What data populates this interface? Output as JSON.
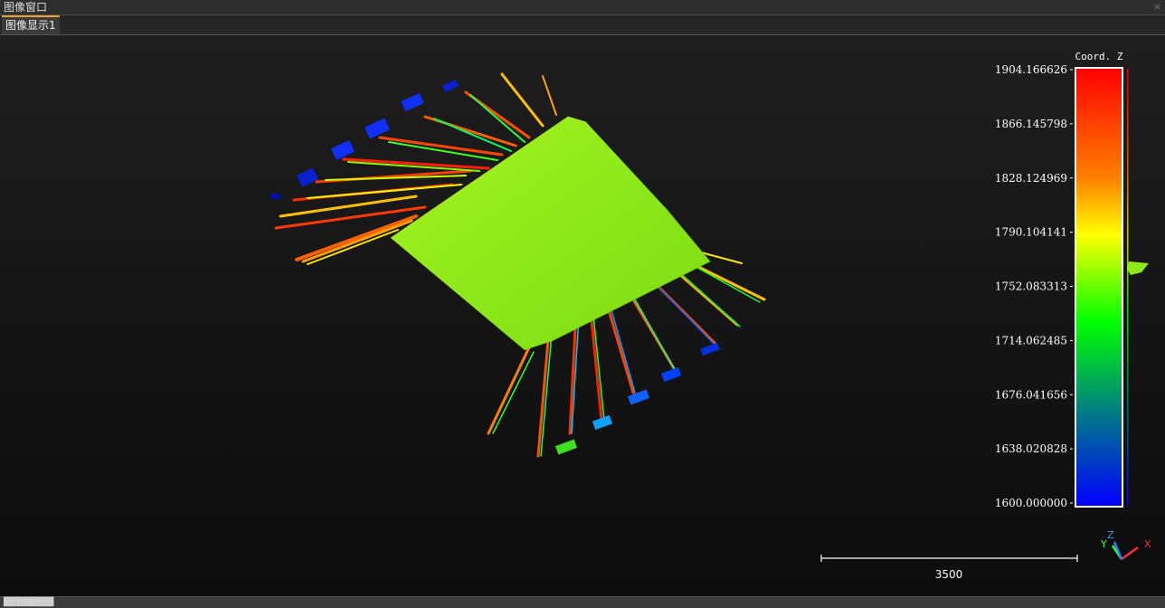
{
  "window": {
    "title": "图像窗口",
    "close_glyph": "×"
  },
  "tabs": [
    {
      "label": "图像显示1",
      "active": true
    }
  ],
  "viewer": {
    "scalar_field": "Coord. Z",
    "colorbar": {
      "min": 1600.0,
      "max": 1904.166626,
      "ticks": [
        "1904.166626",
        "1866.145798",
        "1828.124969",
        "1790.104141",
        "1752.083313",
        "1714.062485",
        "1676.041656",
        "1638.020828",
        "1600.000000"
      ],
      "colors": [
        "#ff0000",
        "#ff7f00",
        "#ffff00",
        "#00ff00",
        "#007f7f",
        "#0000ff"
      ]
    },
    "scale_bar_label": "3500",
    "axes": {
      "x": "X",
      "y": "Y",
      "z": "Z"
    }
  },
  "status_text": "████████"
}
